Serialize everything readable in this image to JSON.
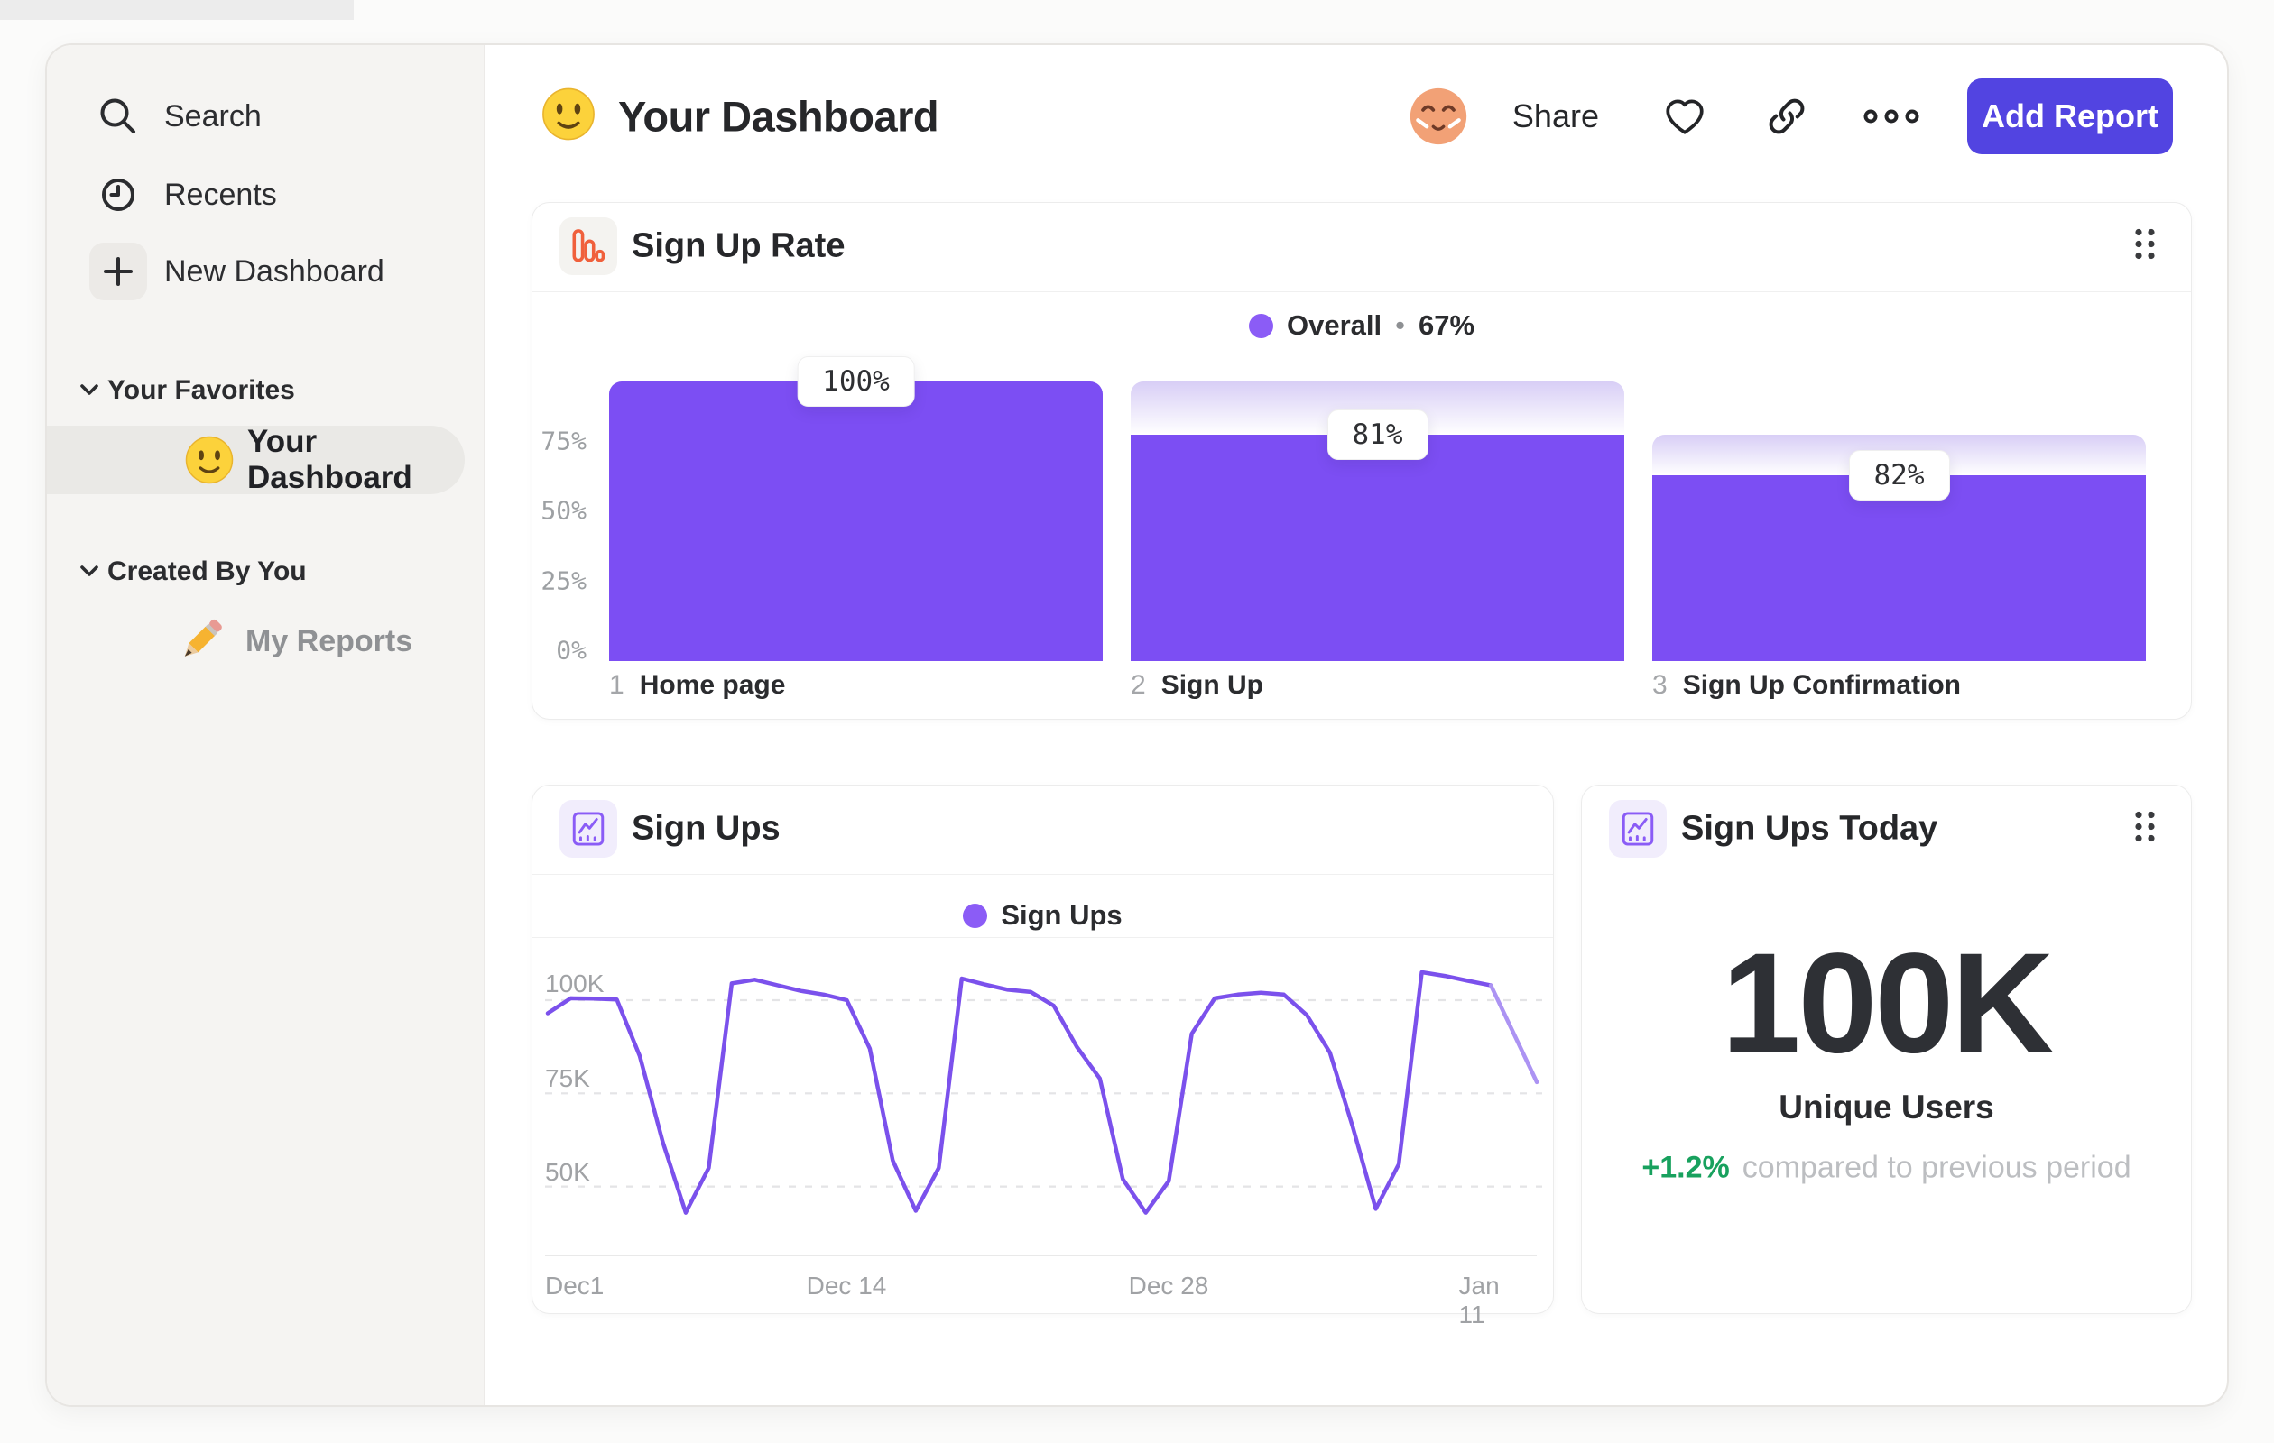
{
  "colors": {
    "accent_purple": "#7C4EF3",
    "funnel_gradient_top": "#D8CEF6",
    "legend_dot": "#8B5CF6",
    "line_main": "#7B51EC",
    "line_projection": "#AC93F3",
    "button_indigo": "#5244E1",
    "delta_green": "#18A15E",
    "funnel_card_icon_orange": "#F0603C"
  },
  "sidebar": {
    "items": [
      {
        "label": "Search"
      },
      {
        "label": "Recents"
      },
      {
        "label": "New Dashboard"
      }
    ],
    "sections": [
      {
        "header": "Your Favorites",
        "items": [
          {
            "label": "Your Dashboard",
            "active": true
          }
        ]
      },
      {
        "header": "Created By You",
        "items": [
          {
            "label": "My Reports"
          }
        ]
      }
    ]
  },
  "header": {
    "title": "Your Dashboard",
    "share_label": "Share",
    "add_report_label": "Add Report"
  },
  "cards": {
    "funnel": {
      "title": "Sign Up Rate"
    },
    "line": {
      "title": "Sign Ups"
    },
    "stat": {
      "title": "Sign Ups Today",
      "value": "100K",
      "label": "Unique Users",
      "delta": "+1.2%",
      "delta_note": "compared to previous period"
    }
  },
  "chart_data": [
    {
      "type": "bar",
      "subtype": "funnel",
      "title": "Sign Up Rate",
      "legend": {
        "label": "Overall",
        "separator": "•",
        "value": "67%"
      },
      "steps": [
        {
          "number": "1",
          "category": "Home page",
          "conversion_pct": 100,
          "cumulative_pct": 100,
          "value_label": "100%"
        },
        {
          "number": "2",
          "category": "Sign Up",
          "conversion_pct": 81,
          "cumulative_pct": 81,
          "value_label": "81%"
        },
        {
          "number": "3",
          "category": "Sign Up Confirmation",
          "conversion_pct": 82,
          "cumulative_pct": 66.4,
          "value_label": "82%"
        }
      ],
      "y_tick_labels": [
        "75%",
        "50%",
        "25%",
        "0%"
      ],
      "y_tick_values": [
        75,
        50,
        25,
        0
      ],
      "ylim": [
        0,
        100
      ],
      "legend_position": "top-center",
      "grid": "off"
    },
    {
      "type": "line",
      "title": "Sign Ups",
      "legend": {
        "label": "Sign Ups"
      },
      "series": [
        {
          "name": "Sign Ups",
          "x_days": [
            0,
            1,
            2,
            3,
            4,
            5,
            6,
            7,
            8,
            9,
            10,
            11,
            12,
            13,
            14,
            15,
            16,
            17,
            18,
            19,
            20,
            21,
            22,
            23,
            24,
            25,
            26,
            27,
            28,
            29,
            30,
            31,
            32,
            33,
            34,
            35,
            36,
            37,
            38,
            39,
            40,
            41
          ],
          "values_k": [
            96.5,
            100.5,
            100.4,
            100.2,
            85,
            62,
            43,
            55,
            104.5,
            105.5,
            104,
            102.5,
            101.5,
            100,
            87,
            57,
            43.5,
            55,
            105.8,
            104.2,
            102.8,
            102.2,
            98.5,
            87.5,
            79,
            52,
            43,
            51.5,
            91,
            100.5,
            101.5,
            102,
            101.5,
            96,
            86,
            66,
            44,
            56,
            107.5,
            106.5,
            105.2,
            104
          ]
        }
      ],
      "projection_tail": {
        "x_days": [
          41,
          43
        ],
        "values_k": [
          104,
          78
        ]
      },
      "x_ticks": [
        {
          "label": "Dec1",
          "day": 0
        },
        {
          "label": "Dec 14",
          "day": 13
        },
        {
          "label": "Dec 28",
          "day": 27
        },
        {
          "label": "Jan 11",
          "day": 41
        }
      ],
      "y_ticks": [
        {
          "label": "100K",
          "value": 100
        },
        {
          "label": "75K",
          "value": 75
        },
        {
          "label": "50K",
          "value": 50
        }
      ],
      "xlim_days": [
        0,
        43
      ],
      "ylim_k": [
        31,
        117
      ],
      "grid": "dashed-horizontal",
      "legend_position": "top-center"
    }
  ]
}
